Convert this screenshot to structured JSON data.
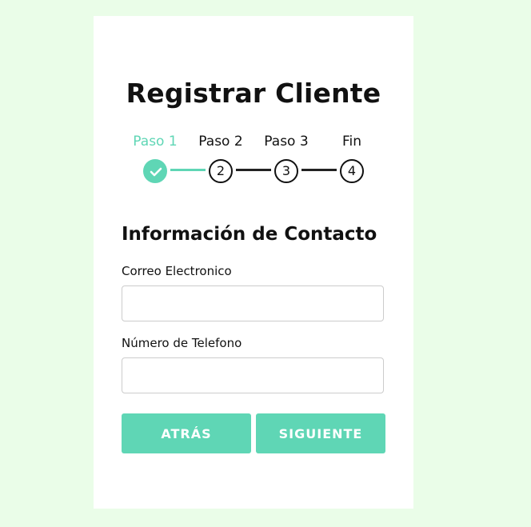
{
  "form": {
    "title": "Registrar Cliente",
    "section_title": "Información de Contacto"
  },
  "steps": [
    {
      "label": "Paso 1",
      "number": "1",
      "state": "done"
    },
    {
      "label": "Paso 2",
      "number": "2",
      "state": "pending"
    },
    {
      "label": "Paso 3",
      "number": "3",
      "state": "pending"
    },
    {
      "label": "Fin",
      "number": "4",
      "state": "pending"
    }
  ],
  "fields": {
    "email": {
      "label": "Correo Electronico",
      "value": "",
      "placeholder": ""
    },
    "phone": {
      "label": "Número de Telefono",
      "value": "",
      "placeholder": ""
    }
  },
  "buttons": {
    "back": "ATRÁS",
    "next": "SIGUIENTE"
  },
  "colors": {
    "accent": "#5fd6b5",
    "page_background": "#eafde8",
    "card_background": "#ffffff",
    "text": "#111111"
  },
  "icons": {
    "step1_done": "check-icon"
  }
}
